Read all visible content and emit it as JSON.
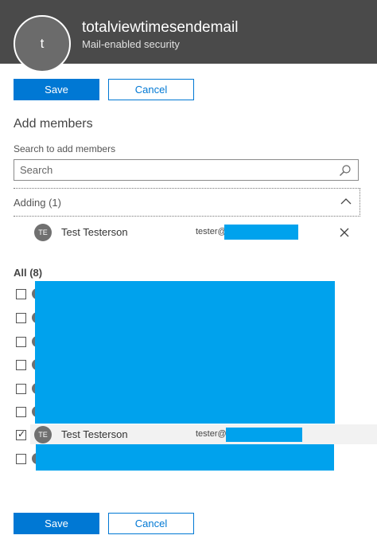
{
  "header": {
    "avatar_letter": "t",
    "group_name": "totalviewtimesendemail",
    "group_type": "Mail-enabled security"
  },
  "actions": {
    "save_label": "Save",
    "cancel_label": "Cancel"
  },
  "add_members": {
    "title": "Add members",
    "search_label": "Search to add members",
    "search_placeholder": "Search",
    "adding_label": "Adding (1)",
    "adding_members": [
      {
        "initials": "TE",
        "name": "Test Testerson",
        "email": "tester@"
      }
    ]
  },
  "all_members": {
    "label": "All (8)",
    "members": [
      {
        "checked": false
      },
      {
        "checked": false
      },
      {
        "checked": false
      },
      {
        "checked": false
      },
      {
        "checked": false
      },
      {
        "checked": false
      },
      {
        "checked": true,
        "initials": "TE",
        "name": "Test Testerson",
        "email": "tester@"
      },
      {
        "checked": false
      }
    ]
  },
  "colors": {
    "header_bg": "#4a4a4a",
    "primary": "#0078d4",
    "redaction": "#00a2ed"
  },
  "icons": {
    "search": "search-icon",
    "collapse": "chevron-up-icon",
    "remove": "close-icon",
    "check": "checkmark-icon"
  }
}
